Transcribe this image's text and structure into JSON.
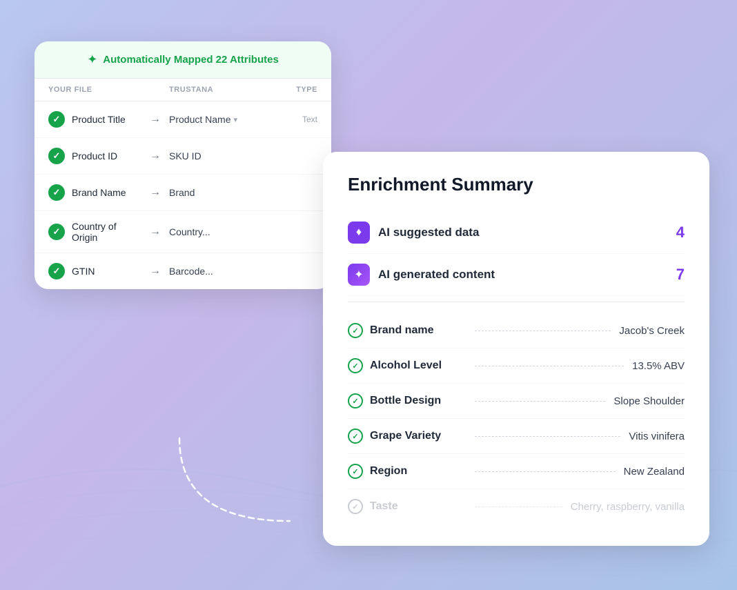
{
  "page": {
    "background": "linear-gradient(135deg, #b8c8f0 0%, #c5b8e8 40%, #a8c4e8 100%)"
  },
  "mapping_card": {
    "header": {
      "icon": "✦",
      "text": "Automatically Mapped 22 Attributes"
    },
    "columns": {
      "your_file": "YOUR FILE",
      "trustana": "TRUSTANA",
      "type": "TYPE"
    },
    "rows": [
      {
        "your_file": "Product Title",
        "trustana": "Product Name",
        "has_dropdown": true,
        "type": "Text"
      },
      {
        "your_file": "Product ID",
        "trustana": "SKU ID",
        "has_dropdown": false,
        "type": ""
      },
      {
        "your_file": "Brand Name",
        "trustana": "Brand",
        "has_dropdown": false,
        "type": ""
      },
      {
        "your_file": "Country of Origin",
        "trustana": "Country...",
        "has_dropdown": false,
        "type": ""
      },
      {
        "your_file": "GTIN",
        "trustana": "Barcode...",
        "has_dropdown": false,
        "type": ""
      }
    ]
  },
  "enrichment_card": {
    "title": "Enrichment Summary",
    "ai_rows": [
      {
        "icon": "♦",
        "label": "AI suggested data",
        "count": "4",
        "type": "suggested"
      },
      {
        "icon": "✦",
        "label": "AI generated content",
        "count": "7",
        "type": "generated"
      }
    ],
    "attributes": [
      {
        "name": "Brand name",
        "value": "Jacob's Creek",
        "faded": false
      },
      {
        "name": "Alcohol Level",
        "value": "13.5%  ABV",
        "faded": false
      },
      {
        "name": "Bottle Design",
        "value": "Slope Shoulder",
        "faded": false
      },
      {
        "name": "Grape Variety",
        "value": "Vitis vinifera",
        "faded": false
      },
      {
        "name": "Region",
        "value": "New Zealand",
        "faded": false
      },
      {
        "name": "Taste",
        "value": "Cherry, raspberry, vanilla",
        "faded": true
      }
    ]
  }
}
